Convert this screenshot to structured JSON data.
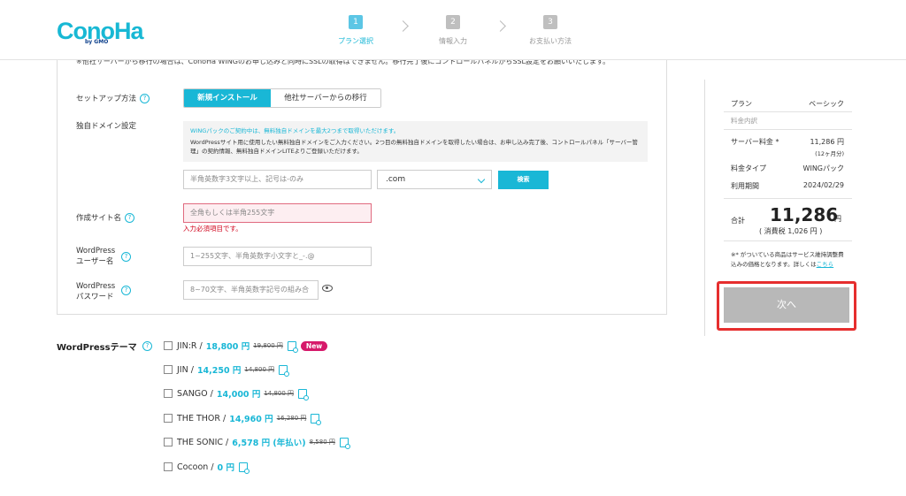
{
  "header": {
    "logo": "ConoHa",
    "logo_sub": "by GMO",
    "steps": [
      {
        "num": "1",
        "label": "プラン選択"
      },
      {
        "num": "2",
        "label": "情報入力"
      },
      {
        "num": "3",
        "label": "お支払い方法"
      }
    ]
  },
  "form": {
    "top_note": "※他社サーバーから移行の場合は、ConoHa WINGのお申し込みと同時にSSLの取得はできません。移行完了後にコントロールパネルからSSL設定をお願いいたします。",
    "setup_method": {
      "label": "セットアップ方法",
      "help": "?",
      "options": [
        "新規インストール",
        "他社サーバーからの移行"
      ]
    },
    "domain": {
      "label": "独自ドメイン設定",
      "info_blue": "WINGパックのご契約中は、無料独自ドメインを最大2つまで取得いただけます。",
      "info_text": "WordPressサイト用に使用したい無料独自ドメインをご入力ください。2つ目の無料独自ドメインを取得したい場合は、お申し込み完了後、コントロールパネル「サーバー管理」の契約情報、無料独自ドメインLITEよりご登録いただけます。",
      "placeholder": "半角英数字3文字以上、記号は-のみ",
      "tld": ".com",
      "search_button": "検索"
    },
    "site_name": {
      "label": "作成サイト名",
      "help": "?",
      "placeholder": "全角もしくは半角255文字",
      "error": "入力必須項目です。"
    },
    "wp_user": {
      "label_line1": "WordPress",
      "label_line2": "ユーザー名",
      "help": "?",
      "placeholder": "1~255文字、半角英数字小文字と_-.@"
    },
    "wp_pass": {
      "label_line1": "WordPress",
      "label_line2": "パスワード",
      "help": "?",
      "placeholder": "8~70文字、半角英数字記号の組み合"
    }
  },
  "themes": {
    "title": "WordPressテーマ",
    "help": "?",
    "items": [
      {
        "name": "JIN:R /",
        "price": "18,800 円",
        "old": "19,800 円",
        "badge": "New"
      },
      {
        "name": "JIN /",
        "price": "14,250 円",
        "old": "14,800 円"
      },
      {
        "name": "SANGO /",
        "price": "14,000 円",
        "old": "14,800 円"
      },
      {
        "name": "THE THOR /",
        "price": "14,960 円",
        "old": "16,280 円"
      },
      {
        "name": "THE SONIC /",
        "price": "6,578 円 (年払い)",
        "old": "8,580 円"
      },
      {
        "name": "Cocoon /",
        "price": "0 円",
        "old": ""
      }
    ]
  },
  "summary": {
    "plan_label": "プラン",
    "plan_value": "ベーシック",
    "breakdown_label": "料金内訳",
    "server_fee_label": "サーバー料金 *",
    "server_fee_value": "11,286 円",
    "server_fee_sub": "(12ヶ月分)",
    "fee_type_label": "料金タイプ",
    "fee_type_value": "WINGパック",
    "period_label": "利用期間",
    "period_value": "2024/02/29",
    "total_label": "合計",
    "total_value": "11,286",
    "total_unit": "円",
    "tax": "( 消費税 1,026 円 )",
    "note": "※* がついている商品はサービス維持調整費込みの価格となります。詳しくは",
    "note_link": "こちら",
    "next_button": "次へ"
  },
  "colors": {
    "accent": "#19b7d6",
    "error": "#d0021b",
    "highlight": "#e62e2e",
    "badge": "#d6196a"
  }
}
